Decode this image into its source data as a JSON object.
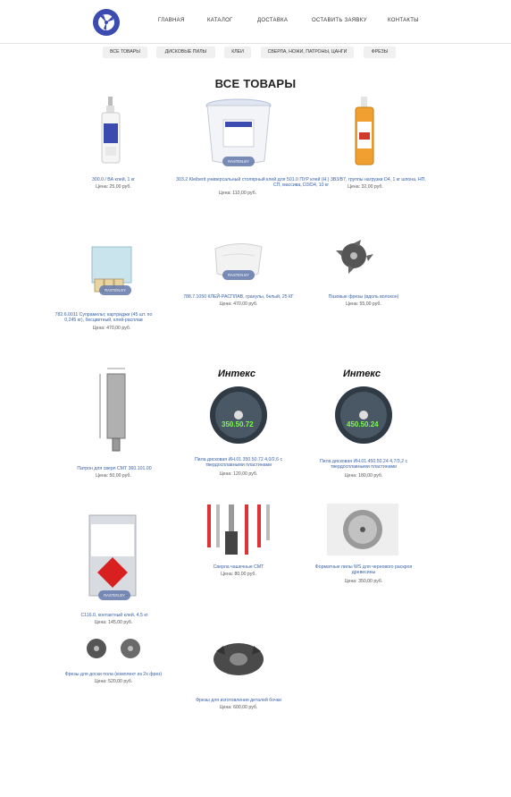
{
  "nav": {
    "items": [
      "ГЛАВНАЯ",
      "КАТАЛОГ",
      "ДОСТАВКА",
      "ОСТАВИТЬ ЗАЯВКУ",
      "КОНТАКТЫ"
    ]
  },
  "categories": [
    "ВСЕ ТОВАРЫ",
    "ДИСКОВЫЕ ПИЛЫ",
    "КЛЕИ",
    "СВЕРЛА, НОЖИ, ПАТРОНЫ, ЦАНГИ",
    "ФРЕЗЫ"
  ],
  "page_title": "ВСЕ ТОВАРЫ",
  "badge_text": "RASTEN.BY",
  "saw_labels": [
    "350.50.72",
    "450.50.24"
  ],
  "saw_brand": "Интекс",
  "products": [
    {
      "name": "300.0 / ВА клей, 1 кг",
      "price": "Цена: 25,00 руб."
    },
    {
      "name": "303.2 Kleiberit универсальный столярный клей для 501.0 ПУР клей (Н.) 3B3/B7, группы нагрузки D4, 1 кг шпона, НП, СП, массива, D3/D4, 10 кг",
      "price": "Цена: 110,00 руб."
    },
    {
      "name": "",
      "price": "Цена: 32,00 руб."
    },
    {
      "name": "782.6.0011 Супрамельт, картриджи (45 шт. по 0,245 кг), бесцветный, клей-расплав",
      "price": "Цена: 470,00 руб."
    },
    {
      "name": "788.7.1050 КЛЕЙ-РАСПЛАВ, гранулы, белый, 25 КГ",
      "price": "Цена: 470,00 руб."
    },
    {
      "name": "Пазовые фрезы (вдоль волокон)",
      "price": "Цена: 55,00 руб."
    },
    {
      "name": "Патрон для сверл СМТ 360.101.00",
      "price": "Цена: 50,00 руб."
    },
    {
      "name": "Пила дисковая ИН.01.350.50.72 4,0/2,6 с твердосплавными пластинами",
      "price": "Цена: 120,00 руб."
    },
    {
      "name": "Пила дисковая ИН.01.450.50.24 4,7/3,2 с твердосплавными пластинами",
      "price": "Цена: 180,00 руб."
    },
    {
      "name": "С116.0, контактный клей, 4,5 кг",
      "price": "Цена: 145,00 руб."
    },
    {
      "name": "Сверла чашечные СМТ",
      "price": "Цена: 80,00 руб."
    },
    {
      "name": "Форматные пилы WS для чернового раскроя древесины",
      "price": "Цена: 350,00 руб."
    },
    {
      "name": "Фрезы для доски пола (комплект из 2х фрез)",
      "price": "Цена: 520,00 руб."
    },
    {
      "name": "Фрезы для изготовления деталей бочки",
      "price": "Цена: 600,00 руб."
    }
  ],
  "colors": {
    "link": "#3a63a8",
    "logo": "#3b4bb0",
    "pill": "#f0f0f0"
  }
}
